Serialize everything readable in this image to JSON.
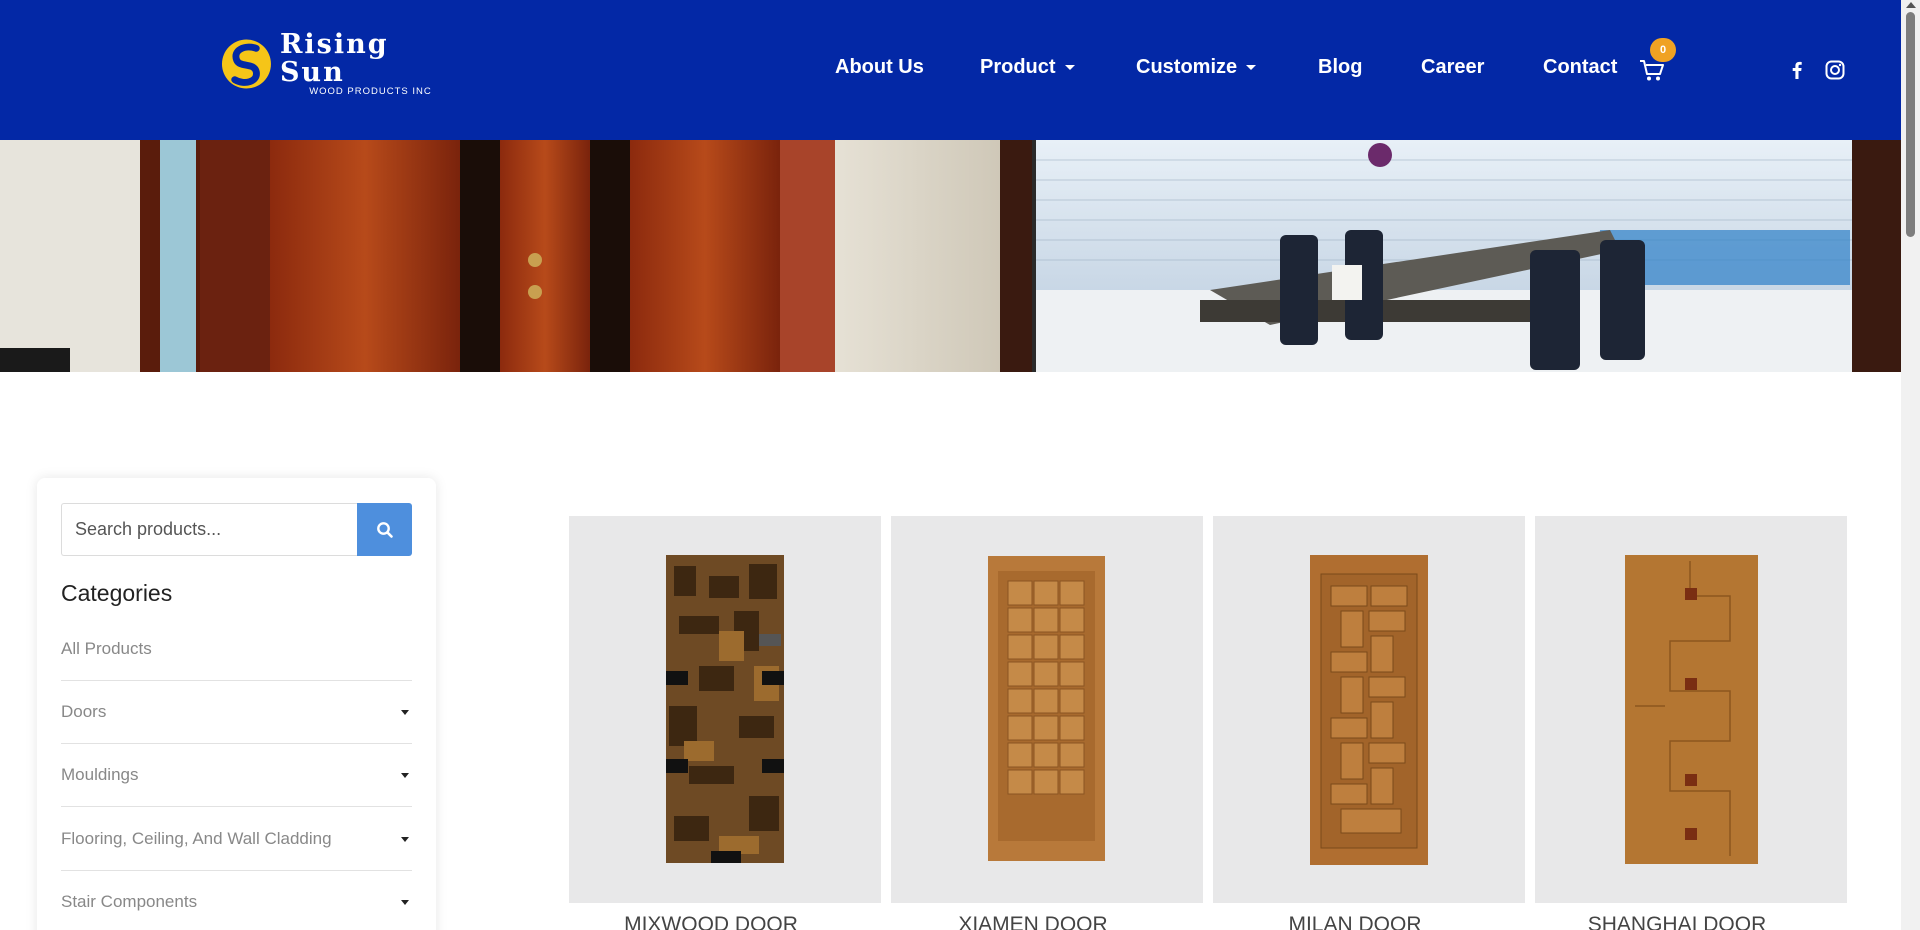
{
  "brand": {
    "name": "Rising Sun",
    "tagline": "WOOD PRODUCTS INC",
    "logo_icon": "sun-swirl-icon",
    "colors": {
      "header_bg": "#0328a6",
      "logo_yellow": "#f5c518",
      "accent_orange": "#f0a223",
      "search_button": "#4e8fdd"
    }
  },
  "nav": {
    "items": [
      {
        "label": "About Us",
        "has_dropdown": false
      },
      {
        "label": "Product",
        "has_dropdown": true
      },
      {
        "label": "Customize",
        "has_dropdown": true
      },
      {
        "label": "Blog",
        "has_dropdown": false
      },
      {
        "label": "Career",
        "has_dropdown": false
      },
      {
        "label": "Contact",
        "has_dropdown": false
      }
    ],
    "cart_count": "0",
    "cart_icon": "cart-icon",
    "social": [
      "facebook-icon",
      "instagram-icon"
    ]
  },
  "sidebar": {
    "search_placeholder": "Search products...",
    "search_icon": "search-icon",
    "categories_title": "Categories",
    "categories": [
      {
        "label": "All Products",
        "expandable": false
      },
      {
        "label": "Doors",
        "expandable": true
      },
      {
        "label": "Mouldings",
        "expandable": true
      },
      {
        "label": "Flooring, Ceiling, And Wall Cladding",
        "expandable": true
      },
      {
        "label": "Stair Components",
        "expandable": true
      }
    ]
  },
  "products": [
    {
      "name": "MIXWOOD DOOR"
    },
    {
      "name": "XIAMEN DOOR"
    },
    {
      "name": "MILAN DOOR"
    },
    {
      "name": "SHANGHAI DOOR"
    }
  ]
}
